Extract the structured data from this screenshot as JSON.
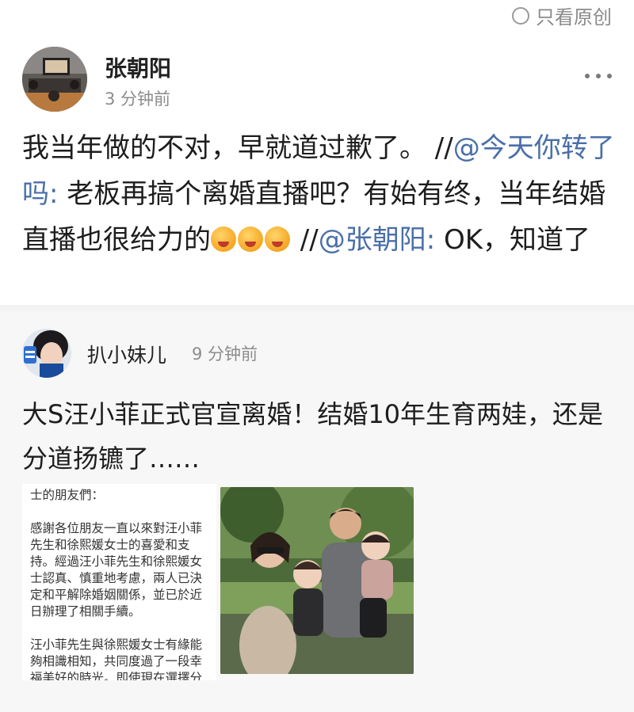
{
  "topbar": {
    "original_only_label": "只看原创"
  },
  "post": {
    "username": "张朝阳",
    "time": "3 分钟前",
    "text_prefix": "我当年做的不对，早就道过歉了。 //",
    "mention_1": "@今天你转了吗:",
    "text_middle": " 老板再搞个离婚直播吧？有始有终，当年结婚直播也很给力的",
    "emoji_name": "kiss-emoji",
    "text_sep": " //",
    "mention_2": "@张朝阳:",
    "text_suffix": " OK，知道了"
  },
  "repost": {
    "username": "扒小妹儿",
    "time": "9 分钟前",
    "text": "大S汪小菲正式官宣离婚！结婚10年生育两娃，还是分道扬镳了……",
    "letter_paragraphs": [
      "士的朋友們：",
      "感謝各位朋友一直以來對汪小菲先生和徐熙媛女士的喜愛和支持。經過汪小菲先生和徐熙媛女士認真、慎重地考慮，兩人已決定和平解除婚姻關係，並已於近日辦理了相關手續。",
      "汪小菲先生與徐熙媛女士有緣能夠相識相知，共同度過了一段幸福美好的時光。即使現在選擇分開，也非常感恩對方的付出。曾經，作為夫妻攜手前行，未來，兩人將以父"
    ]
  },
  "colors": {
    "link": "#4a6fa8",
    "meta": "#8c8c8c",
    "repost_bg": "#f7f7f7"
  }
}
